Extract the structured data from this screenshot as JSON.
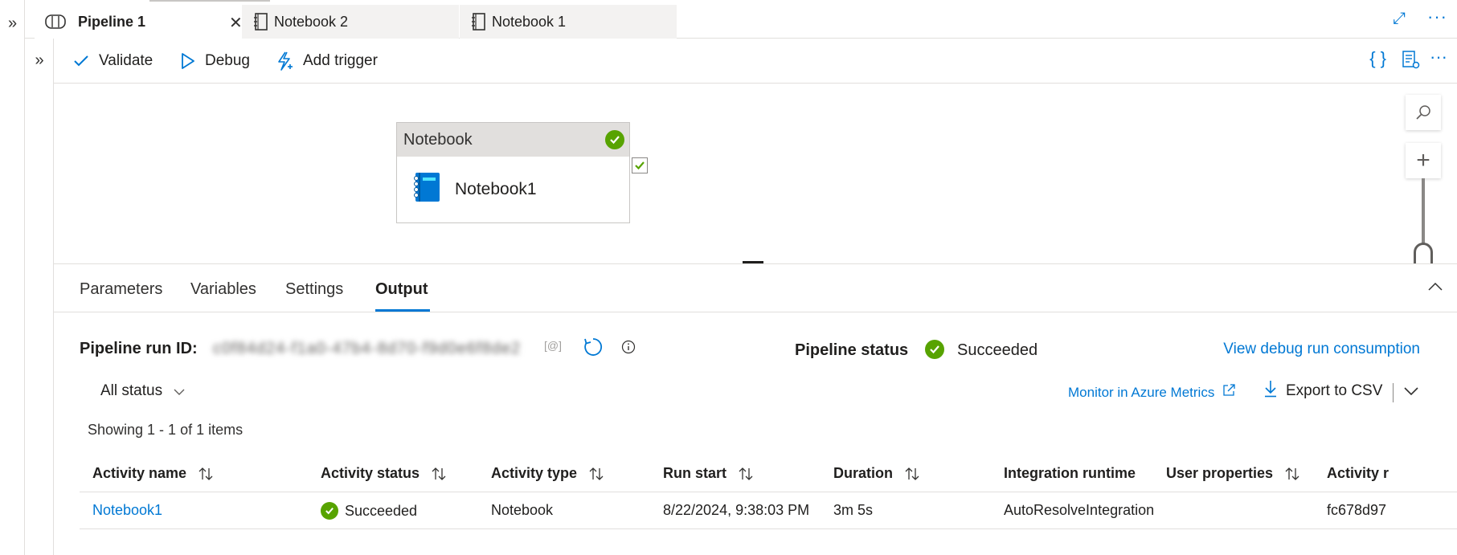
{
  "tabs": [
    {
      "label": "Pipeline 1",
      "icon": "pipeline-icon",
      "active": true
    },
    {
      "label": "Notebook 2",
      "icon": "notebook-tab-icon",
      "active": false
    },
    {
      "label": "Notebook 1",
      "icon": "notebook-tab-icon",
      "active": false
    }
  ],
  "toolbar": {
    "validate_label": "Validate",
    "debug_label": "Debug",
    "add_trigger_label": "Add trigger"
  },
  "canvas": {
    "activity": {
      "type_label": "Notebook",
      "name": "Notebook1",
      "status": "succeeded"
    }
  },
  "panel": {
    "tabs": [
      "Parameters",
      "Variables",
      "Settings",
      "Output"
    ],
    "active_tab": "Output",
    "run_id_label": "Pipeline run ID:",
    "run_id_value": "c0f84d24-f1a0-47b4-8d70-f9d0e6f8de2",
    "pipeline_status_label": "Pipeline status",
    "pipeline_status_value": "Succeeded",
    "debug_consumption_link": "View debug run consumption",
    "status_filter": "All status",
    "monitor_link": "Monitor in Azure Metrics",
    "export_label": "Export to CSV",
    "showing_text": "Showing 1 - 1 of 1 items"
  },
  "table": {
    "headers": [
      "Activity name",
      "Activity status",
      "Activity type",
      "Run start",
      "Duration",
      "Integration runtime",
      "User properties",
      "Activity r"
    ],
    "rows": [
      [
        "Notebook1",
        "Succeeded",
        "Notebook",
        "8/22/2024, 9:38:03 PM",
        "3m 5s",
        "AutoResolveIntegration",
        "",
        "fc678d97"
      ]
    ]
  },
  "colors": {
    "accent": "#0078d4",
    "success": "#57a300",
    "border": "#e1dfdd"
  }
}
